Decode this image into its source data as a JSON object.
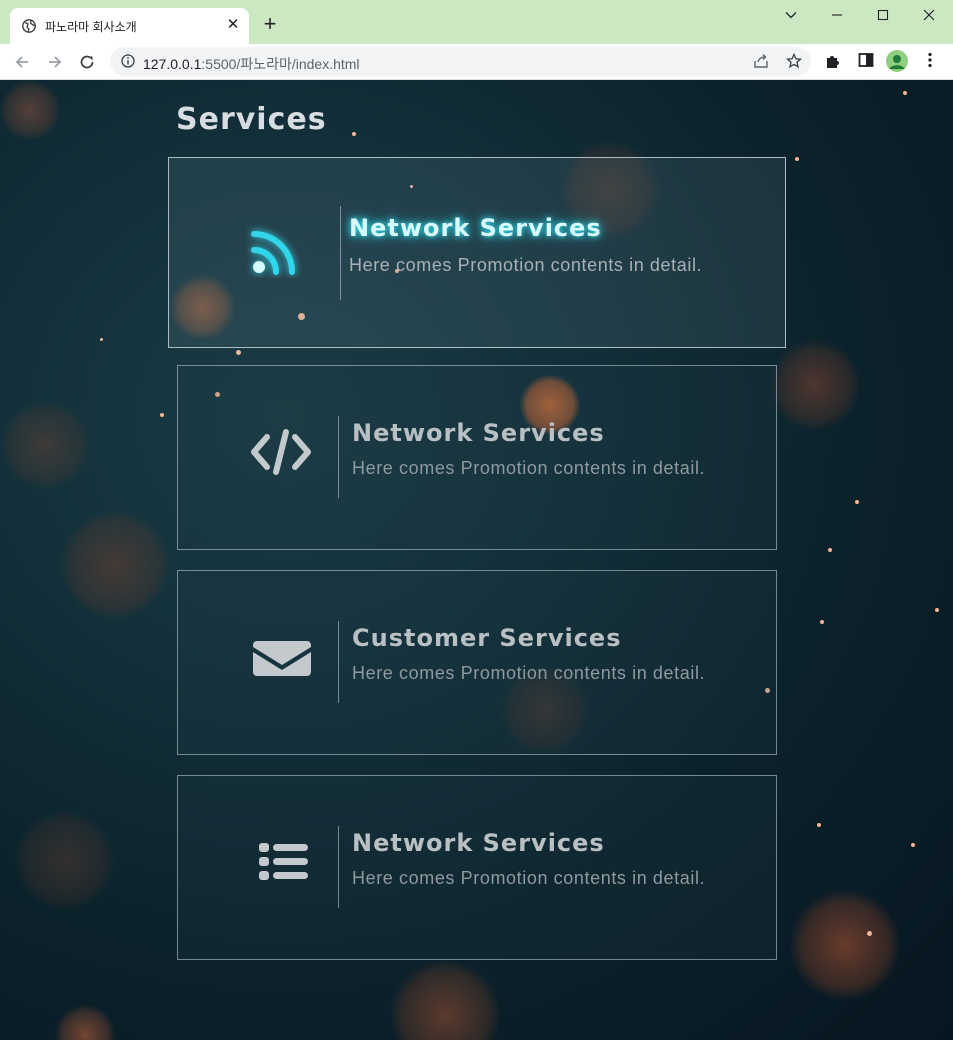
{
  "browser": {
    "tab_title": "파노라마 회사소개",
    "tab_close": "✕",
    "new_tab": "+",
    "url_host": "127.0.0.1",
    "url_rest": ":5500/파노라마/index.html"
  },
  "page": {
    "section_title": "Services",
    "cards": [
      {
        "icon": "rss-icon",
        "title": "Network Services",
        "description": "Here comes Promotion contents in detail.",
        "active": true
      },
      {
        "icon": "code-icon",
        "title": "Network Services",
        "description": "Here comes Promotion contents in detail.",
        "active": false
      },
      {
        "icon": "envelope-icon",
        "title": "Customer Services",
        "description": "Here comes Promotion contents in detail.",
        "active": false
      },
      {
        "icon": "list-icon",
        "title": "Network Services",
        "description": "Here comes Promotion contents in detail.",
        "active": false
      }
    ]
  },
  "colors": {
    "tabbar": "#cbe8c3",
    "accent_glow": "#35d7e9",
    "icon_default": "#c3c9cc",
    "background": "#0c222b"
  }
}
